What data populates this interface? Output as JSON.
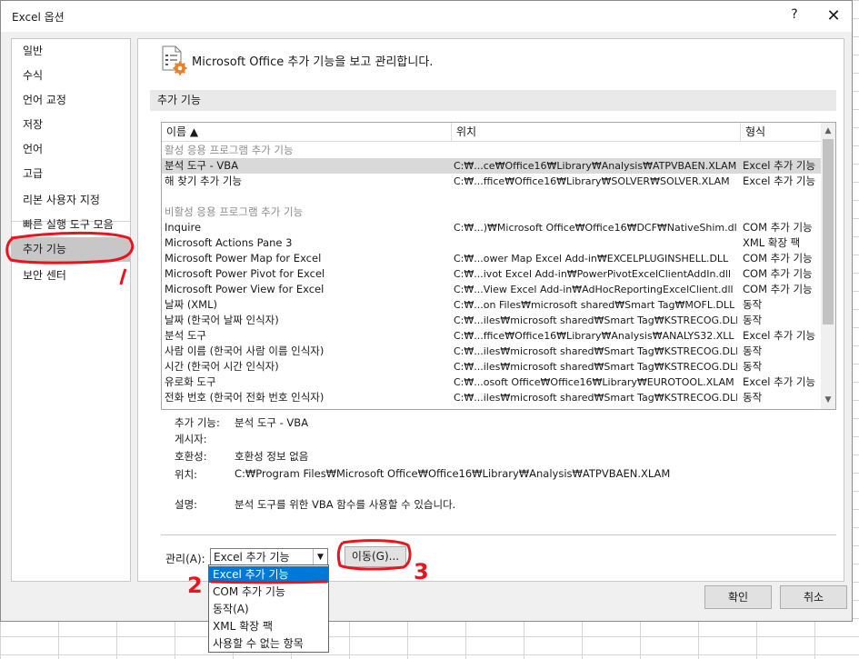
{
  "window": {
    "title": "Excel 옵션",
    "help": "?",
    "close": "✕"
  },
  "sidebar": {
    "items": [
      {
        "label": "일반"
      },
      {
        "label": "수식"
      },
      {
        "label": "언어 교정"
      },
      {
        "label": "저장"
      },
      {
        "label": "언어"
      },
      {
        "label": "고급"
      },
      {
        "label": "리본 사용자 지정"
      },
      {
        "label": "빠른 실행 도구 모음"
      },
      {
        "label": "추가 기능"
      },
      {
        "label": "보안 센터"
      }
    ],
    "selected": "추가 기능"
  },
  "main": {
    "header": "Microsoft Office 추가 기능을 보고 관리합니다.",
    "header_icon": "addins-gear-icon",
    "section": "추가 기능",
    "columns": [
      "이름 ▲",
      "위치",
      "형식"
    ],
    "active_group": "활성 응용 프로그램 추가 기능",
    "active_rows": [
      [
        "분석 도구 - VBA",
        "C:₩...ce₩Office16₩Library₩Analysis₩ATPVBAEN.XLAM",
        "Excel 추가 기능"
      ],
      [
        "해 찾기 추가 기능",
        "C:₩...ffice₩Office16₩Library₩SOLVER₩SOLVER.XLAM",
        "Excel 추가 기능"
      ]
    ],
    "inactive_group": "비활성 응용 프로그램 추가 기능",
    "inactive_rows": [
      [
        "Inquire",
        "C:₩...)₩Microsoft Office₩Office16₩DCF₩NativeShim.dll",
        "COM 추가 기능"
      ],
      [
        "Microsoft Actions Pane 3",
        "",
        "XML 확장 팩"
      ],
      [
        "Microsoft Power Map for Excel",
        "C:₩...ower Map Excel Add-in₩EXCELPLUGINSHELL.DLL",
        "COM 추가 기능"
      ],
      [
        "Microsoft Power Pivot for Excel",
        "C:₩...ivot Excel Add-in₩PowerPivotExcelClientAddIn.dll",
        "COM 추가 기능"
      ],
      [
        "Microsoft Power View for Excel",
        "C:₩...View Excel Add-in₩AdHocReportingExcelClient.dll",
        "COM 추가 기능"
      ],
      [
        "날짜 (XML)",
        "C:₩...on Files₩microsoft shared₩Smart Tag₩MOFL.DLL",
        "동작"
      ],
      [
        "날짜 (한국어 날짜 인식자)",
        "C:₩...iles₩microsoft shared₩Smart Tag₩KSTRECOG.DLL",
        "동작"
      ],
      [
        "분석 도구",
        "C:₩...ffice₩Office16₩Library₩Analysis₩ANALYS32.XLL",
        "Excel 추가 기능"
      ],
      [
        "사람 이름 (한국어 사람 이름 인식자)",
        "C:₩...iles₩microsoft shared₩Smart Tag₩KSTRECOG.DLL",
        "동작"
      ],
      [
        "시간 (한국어 시간 인식자)",
        "C:₩...iles₩microsoft shared₩Smart Tag₩KSTRECOG.DLL",
        "동작"
      ],
      [
        "유로화 도구",
        "C:₩...osoft Office₩Office16₩Library₩EUROTOOL.XLAM",
        "Excel 추가 기능"
      ],
      [
        "전화 번호 (한국어 전화 번호 인식자)",
        "C:₩...iles₩microsoft shared₩Smart Tag₩KSTRECOG.DLL",
        "동작"
      ]
    ],
    "details": {
      "addin_label": "추가 기능:",
      "addin_value": "분석 도구 - VBA",
      "publisher_label": "게시자:",
      "publisher_value": "",
      "compat_label": "호환성:",
      "compat_value": "호환성 정보 없음",
      "location_label": "위치:",
      "location_value": "C:₩Program Files₩Microsoft Office₩Office16₩Library₩Analysis₩ATPVBAEN.XLAM",
      "desc_label": "설명:",
      "desc_value": "분석 도구를 위한 VBA 함수를 사용할 수 있습니다."
    },
    "manage": {
      "label": "관리(A):",
      "selected": "Excel 추가 기능",
      "go_button": "이동(G)...",
      "options": [
        "Excel 추가 기능",
        "COM 추가 기능",
        "동작(A)",
        "XML 확장 팩",
        "사용할 수 없는 항목"
      ]
    }
  },
  "buttons": {
    "ok": "확인",
    "cancel": "취소"
  },
  "annotations": {
    "red_color": "#e8141e",
    "num2": "2",
    "num3": "3"
  }
}
